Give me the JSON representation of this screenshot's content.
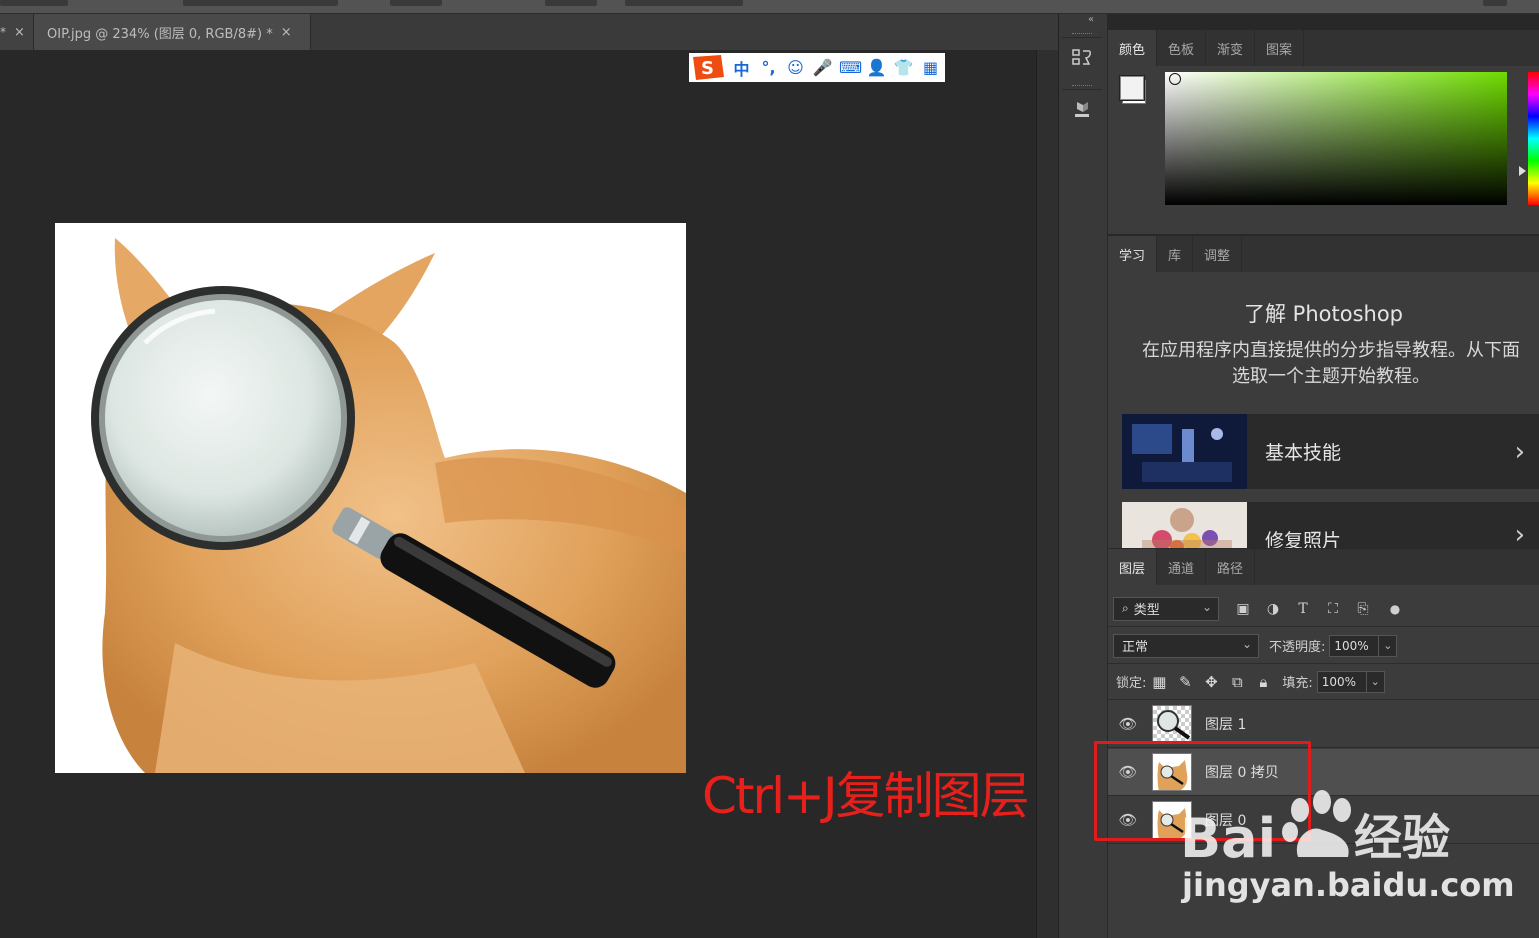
{
  "document_tabs": {
    "prev_tab_close": "×",
    "active_title": "OIP.jpg @ 234% (图层 0, RGB/8#) *",
    "active_close": "×"
  },
  "ime_toolbar": {
    "items": [
      "中",
      "°,",
      "☺",
      "🎤",
      "⌨",
      "👤",
      "👕",
      "▦"
    ]
  },
  "annotation": "Ctrl+J复制图层",
  "color_panel": {
    "tabs": [
      "颜色",
      "色板",
      "渐变",
      "图案"
    ],
    "active_tab": 0,
    "field_hue_color": "#6fdc00",
    "foreground_color": "#f2f2f2",
    "background_color": "#ffffff"
  },
  "learn_panel": {
    "tabs": [
      "学习",
      "库",
      "调整"
    ],
    "active_tab": 0,
    "title": "了解 Photoshop",
    "description": "在应用程序内直接提供的分步指导教程。从下面选取一个主题开始教程。",
    "cards": [
      {
        "label": "基本技能",
        "chevron": "›"
      },
      {
        "label": "修复照片",
        "chevron": "›"
      }
    ]
  },
  "layers_panel": {
    "tabs": [
      "图层",
      "通道",
      "路径"
    ],
    "active_tab": 0,
    "filter_label": "类型",
    "filter_icons": [
      "image-filter-icon",
      "adjustment-filter-icon",
      "type-filter-icon",
      "shape-filter-icon",
      "smart-object-filter-icon"
    ],
    "blend_mode": "正常",
    "opacity_label": "不透明度:",
    "opacity_value": "100%",
    "lock_label": "锁定:",
    "fill_label": "填充:",
    "fill_value": "100%",
    "layers": [
      {
        "name": "图层 1",
        "thumb": "magnifier",
        "selected": false
      },
      {
        "name": "图层 0 拷贝",
        "thumb": "cat",
        "selected": true
      },
      {
        "name": "图层 0",
        "thumb": "cat",
        "selected": false
      }
    ]
  },
  "watermark": {
    "brand": "Bai经验",
    "url": "jingyan.baidu.com"
  },
  "colors": {
    "accent_red": "#e8201c",
    "panel_bg": "#3c3c3c",
    "canvas_bg": "#282828"
  }
}
